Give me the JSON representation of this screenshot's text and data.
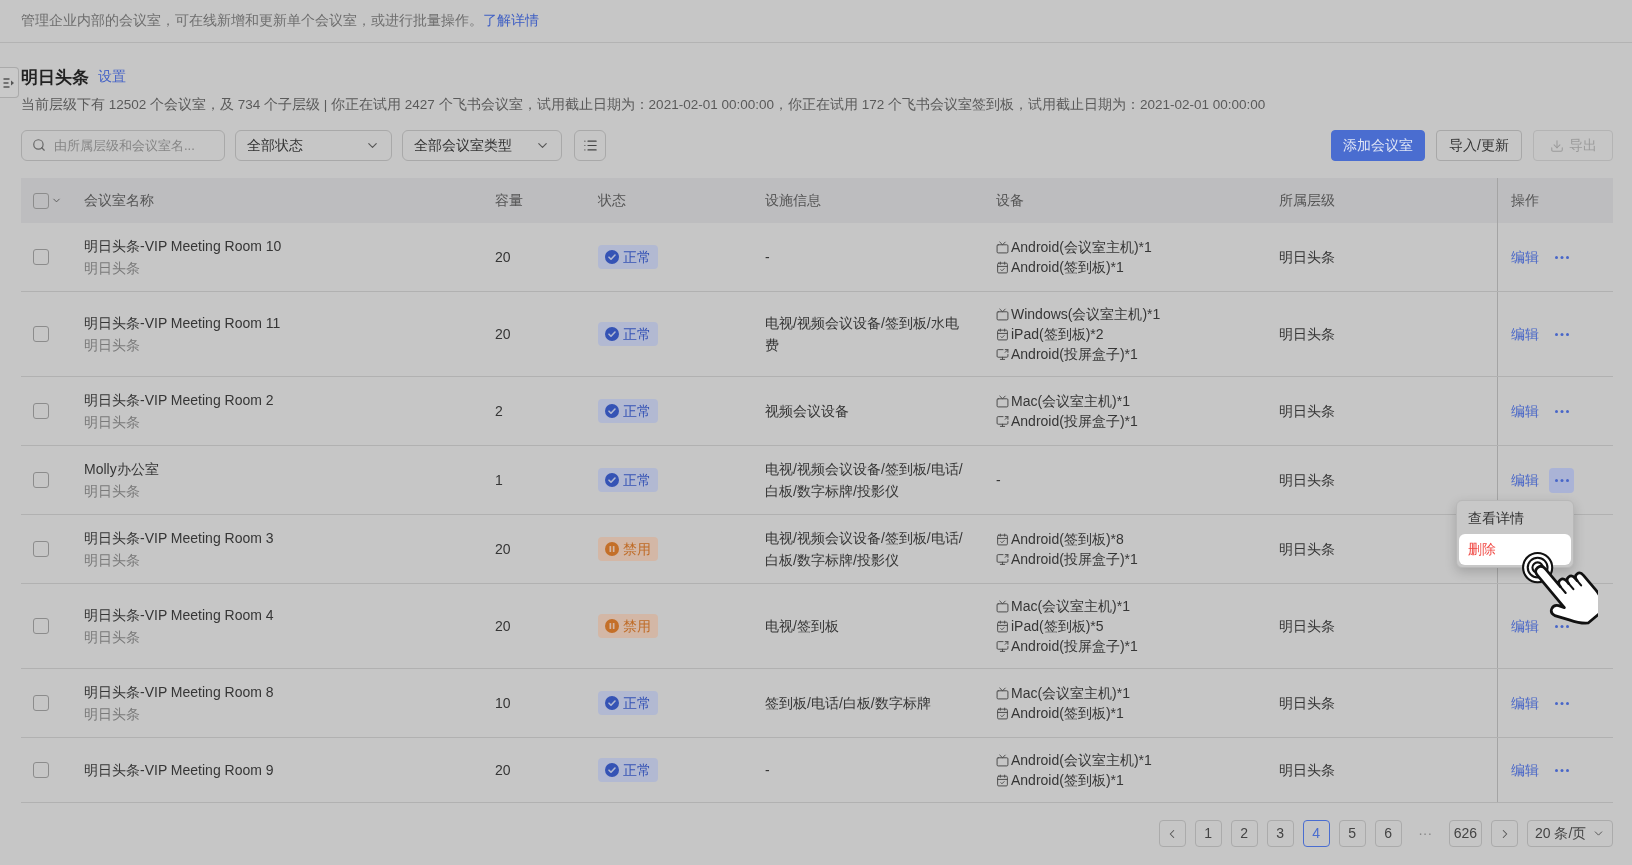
{
  "intro": {
    "text": "管理企业内部的会议室，可在线新增和更新单个会议室，或进行批量操作。",
    "link": "了解详情"
  },
  "org": {
    "title": "明日头条",
    "settings_link": "设置",
    "summary": "当前层级下有 12502 个会议室，及 734 个子层级 | 你正在试用 2427 个飞书会议室，试用截止日期为：2021-02-01 00:00:00，你正在试用 172 个飞书会议室签到板，试用截止日期为：2021-02-01 00:00:00"
  },
  "toolbar": {
    "search": {
      "placeholder": "由所属层级和会议室名..."
    },
    "filters": [
      "全部状态",
      "全部会议室类型"
    ],
    "buttons": [
      {
        "label": "添加会议室",
        "kind": "primary",
        "disabled": false
      },
      {
        "label": "导入/更新",
        "kind": "default",
        "disabled": false
      },
      {
        "label": "导出",
        "kind": "export",
        "disabled": true
      }
    ]
  },
  "table": {
    "select_all": {
      "checked": false
    },
    "columns": [
      "会议室名称",
      "容量",
      "状态",
      "设施信息",
      "设备",
      "所属层级",
      "操作"
    ],
    "rows": [
      {
        "checked": false,
        "name": "明日头条-VIP Meeting Room 10",
        "parent": "明日头条",
        "capacity": "20",
        "status": {
          "label": "正常",
          "kind": "normal"
        },
        "facilities": "-",
        "devices": [
          {
            "kind": "host",
            "text": "Android(会议室主机)*1"
          },
          {
            "kind": "checkin",
            "text": "Android(签到板)*1"
          }
        ],
        "level": "明日头条",
        "actions": {
          "edit": "编辑",
          "menu_open": false
        }
      },
      {
        "checked": false,
        "name": "明日头条-VIP Meeting Room 11",
        "parent": "明日头条",
        "capacity": "20",
        "status": {
          "label": "正常",
          "kind": "normal"
        },
        "facilities": "电视/视频会议设备/签到板/水电费",
        "devices": [
          {
            "kind": "host",
            "text": "Windows(会议室主机)*1"
          },
          {
            "kind": "checkin",
            "text": "iPad(签到板)*2"
          },
          {
            "kind": "cast",
            "text": "Android(投屏盒子)*1"
          }
        ],
        "level": "明日头条",
        "actions": {
          "edit": "编辑",
          "menu_open": false
        }
      },
      {
        "checked": false,
        "name": "明日头条-VIP Meeting Room 2",
        "parent": "明日头条",
        "capacity": "2",
        "status": {
          "label": "正常",
          "kind": "normal"
        },
        "facilities": "视频会议设备",
        "devices": [
          {
            "kind": "host",
            "text": "Mac(会议室主机)*1"
          },
          {
            "kind": "cast",
            "text": "Android(投屏盒子)*1"
          }
        ],
        "level": "明日头条",
        "actions": {
          "edit": "编辑",
          "menu_open": false
        }
      },
      {
        "checked": false,
        "name": "Molly办公室",
        "parent": "明日头条",
        "capacity": "1",
        "status": {
          "label": "正常",
          "kind": "normal"
        },
        "facilities": "电视/视频会议设备/签到板/电话/白板/数字标牌/投影仪",
        "devices": [
          {
            "kind": "none",
            "text": "-"
          }
        ],
        "level": "明日头条",
        "actions": {
          "edit": "编辑",
          "menu_open": true
        }
      },
      {
        "checked": false,
        "name": "明日头条-VIP Meeting Room 3",
        "parent": "明日头条",
        "capacity": "20",
        "status": {
          "label": "禁用",
          "kind": "disabled"
        },
        "facilities": "电视/视频会议设备/签到板/电话/白板/数字标牌/投影仪",
        "devices": [
          {
            "kind": "checkin",
            "text": "Android(签到板)*8"
          },
          {
            "kind": "cast",
            "text": "Android(投屏盒子)*1"
          }
        ],
        "level": "明日头条"
      },
      {
        "checked": false,
        "name": "明日头条-VIP Meeting Room 4",
        "parent": "明日头条",
        "capacity": "20",
        "status": {
          "label": "禁用",
          "kind": "disabled"
        },
        "facilities": "电视/签到板",
        "devices": [
          {
            "kind": "host",
            "text": "Mac(会议室主机)*1"
          },
          {
            "kind": "checkin",
            "text": "iPad(签到板)*5"
          },
          {
            "kind": "cast",
            "text": "Android(投屏盒子)*1"
          }
        ],
        "level": "明日头条",
        "actions": {
          "edit": "编辑",
          "menu_open": false
        }
      },
      {
        "checked": false,
        "name": "明日头条-VIP Meeting Room 8",
        "parent": "明日头条",
        "capacity": "10",
        "status": {
          "label": "正常",
          "kind": "normal"
        },
        "facilities": "签到板/电话/白板/数字标牌",
        "devices": [
          {
            "kind": "host",
            "text": "Mac(会议室主机)*1"
          },
          {
            "kind": "checkin",
            "text": "Android(签到板)*1"
          }
        ],
        "level": "明日头条",
        "actions": {
          "edit": "编辑",
          "menu_open": false
        }
      },
      {
        "checked": false,
        "name": "明日头条-VIP Meeting Room 9",
        "capacity": "20",
        "status": {
          "label": "正常",
          "kind": "normal"
        },
        "facilities": "-",
        "devices": [
          {
            "kind": "host",
            "text": "Android(会议室主机)*1"
          },
          {
            "kind": "checkin",
            "text": "Android(签到板)*1"
          }
        ],
        "level": "明日头条",
        "actions": {
          "edit": "编辑",
          "menu_open": false
        }
      }
    ]
  },
  "row_menu": {
    "items": [
      {
        "label": "查看详情",
        "kind": "normal",
        "selected": false
      },
      {
        "label": "删除",
        "kind": "danger",
        "selected": true
      }
    ]
  },
  "pagination": {
    "pages": [
      {
        "label": "1",
        "kind": "page",
        "selected": false
      },
      {
        "label": "2",
        "kind": "page",
        "selected": false
      },
      {
        "label": "3",
        "kind": "page",
        "selected": false
      },
      {
        "label": "4",
        "kind": "page",
        "selected": true
      },
      {
        "label": "5",
        "kind": "page",
        "selected": false
      },
      {
        "label": "6",
        "kind": "page",
        "selected": false
      },
      {
        "label": "···",
        "kind": "ellipsis",
        "selected": false
      },
      {
        "label": "626",
        "kind": "page",
        "selected": false
      }
    ],
    "page_size": "20 条/页"
  }
}
